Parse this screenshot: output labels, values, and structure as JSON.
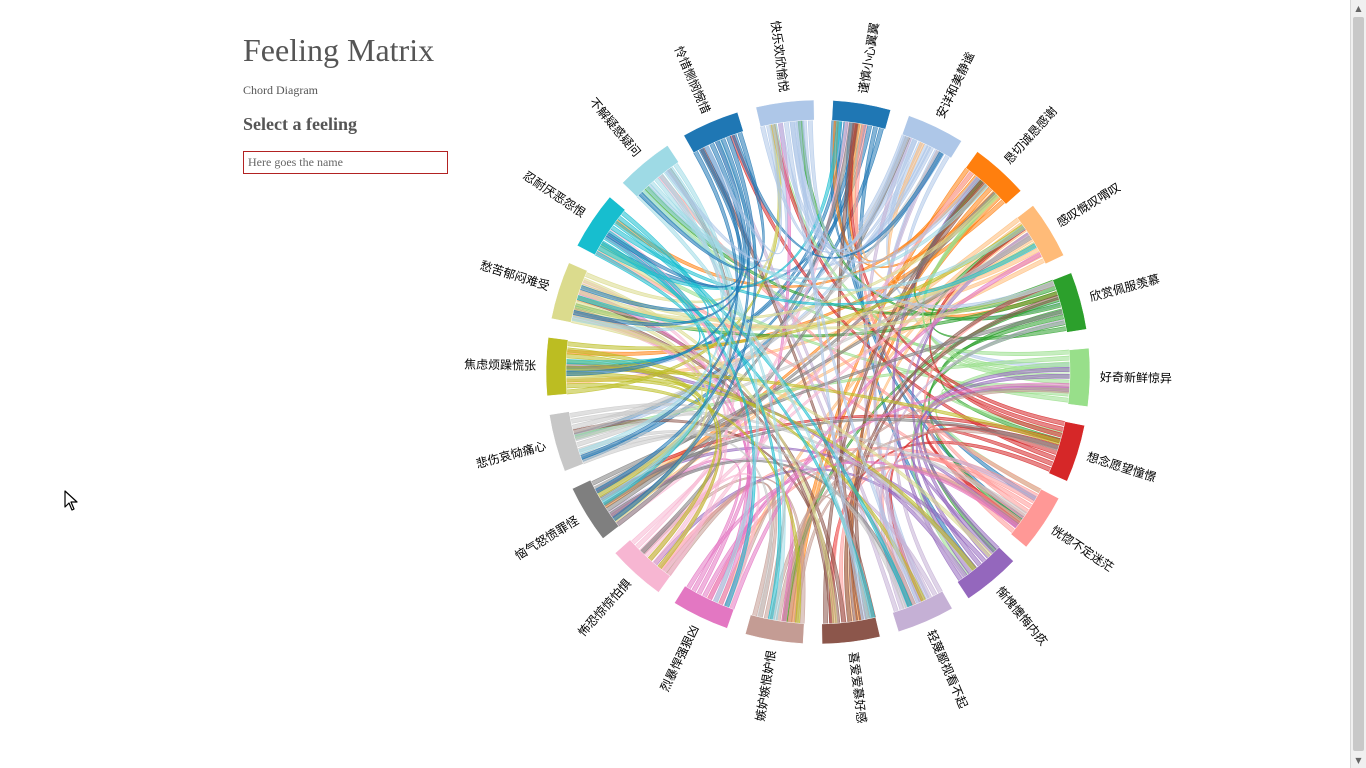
{
  "header": {
    "title": "Feeling Matrix",
    "subtitle": "Chord Diagram",
    "select_heading": "Select a feeling"
  },
  "search": {
    "placeholder": "Here goes the name",
    "value": ""
  },
  "feelings": [
    {
      "label": "谨慎小心翼翼",
      "color": "#1f77b4"
    },
    {
      "label": "安详和美静谧",
      "color": "#aec7e8"
    },
    {
      "label": "恳切诚恳感谢",
      "color": "#ff7f0e"
    },
    {
      "label": "感叹慨叹喟叹",
      "color": "#ffbb78"
    },
    {
      "label": "欣赏佩服羡慕",
      "color": "#2ca02c"
    },
    {
      "label": "好奇新鲜惊异",
      "color": "#98df8a"
    },
    {
      "label": "想念愿望憧憬",
      "color": "#d62728"
    },
    {
      "label": "恍惚不定迷茫",
      "color": "#ff9896"
    },
    {
      "label": "惭愧懊悔内疚",
      "color": "#9467bd"
    },
    {
      "label": "轻蔑鄙视看不起",
      "color": "#c5b0d5"
    },
    {
      "label": "喜爱爱慕好感",
      "color": "#8c564b"
    },
    {
      "label": "嫉妒嫉恨妒恨",
      "color": "#c49c94"
    },
    {
      "label": "烈暴悍强狠凶",
      "color": "#e377c2"
    },
    {
      "label": "怖恐惊惊怕惧",
      "color": "#f7b6d2"
    },
    {
      "label": "恼气怒愤罪怪",
      "color": "#7f7f7f"
    },
    {
      "label": "悲伤哀恸痛心",
      "color": "#c7c7c7"
    },
    {
      "label": "焦虑烦躁慌张",
      "color": "#bcbd22"
    },
    {
      "label": "愁苦郁闷难受",
      "color": "#dbdb8d"
    },
    {
      "label": "忍耐厌恶怨恨",
      "color": "#17becf"
    },
    {
      "label": "不解疑惑疑问",
      "color": "#9edae5"
    },
    {
      "label": "怜惜恻悯惋惜",
      "color": "#1f77b4"
    },
    {
      "label": "快乐欢欣愉悦",
      "color": "#aec7e8"
    }
  ],
  "icons": {
    "scroll_up": "scroll-up-arrow-icon",
    "scroll_down": "scroll-down-arrow-icon",
    "cursor": "mouse-pointer-icon"
  }
}
